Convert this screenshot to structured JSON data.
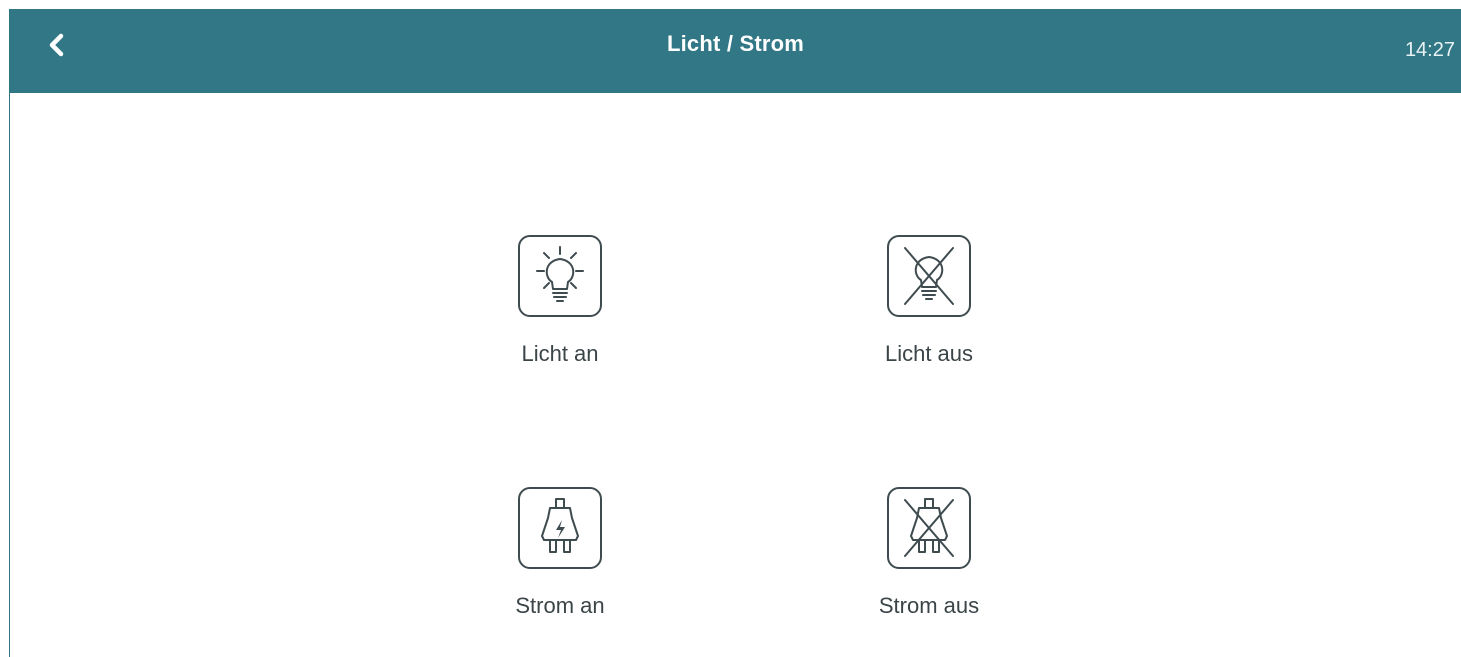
{
  "header": {
    "title": "Licht / Strom",
    "time": "14:27",
    "back_icon": "chevron-left-icon",
    "background": "#317785"
  },
  "tiles": [
    {
      "label": "Licht an",
      "icon": "bulb-on-icon"
    },
    {
      "label": "Licht aus",
      "icon": "bulb-off-icon"
    },
    {
      "label": "Strom an",
      "icon": "plug-on-icon"
    },
    {
      "label": "Strom aus",
      "icon": "plug-off-icon"
    }
  ]
}
